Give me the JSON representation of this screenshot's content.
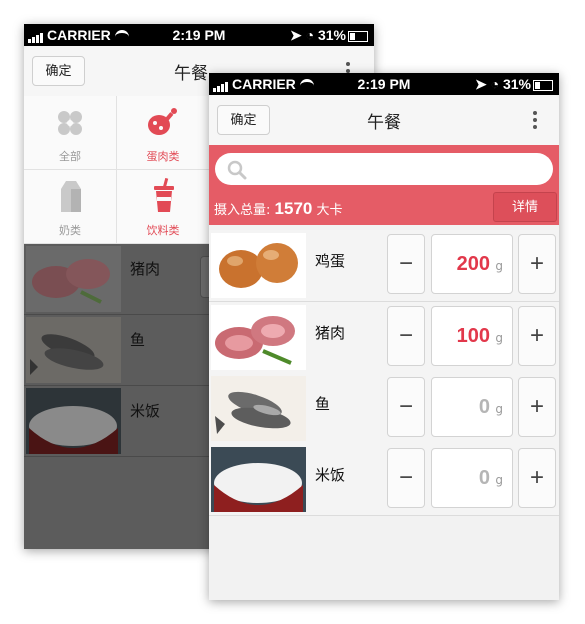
{
  "status_bar": {
    "carrier": "CARRIER",
    "time": "2:19 PM",
    "battery": "31%"
  },
  "back_screen": {
    "confirm_label": "确定",
    "title": "午餐",
    "categories": [
      {
        "label": "全部",
        "icon": "clover-icon",
        "active": false
      },
      {
        "label": "蛋肉类",
        "icon": "meat-icon",
        "active": true
      },
      {
        "label": "奶类",
        "icon": "milk-carton-icon",
        "active": false
      },
      {
        "label": "饮料类",
        "icon": "drink-cup-icon",
        "active": true
      }
    ],
    "foods": [
      {
        "name": "猪肉",
        "image": "pork"
      },
      {
        "name": "鱼",
        "image": "fish"
      },
      {
        "name": "米饭",
        "image": "rice"
      }
    ]
  },
  "front_screen": {
    "confirm_label": "确定",
    "title": "午餐",
    "search": {
      "placeholder": "",
      "icon": "search-icon"
    },
    "summary": {
      "label": "摄入总量:",
      "value": "1570",
      "unit": "大卡"
    },
    "detail_label": "详情",
    "foods": [
      {
        "name": "鸡蛋",
        "image": "eggs",
        "quantity": "200",
        "unit": "g",
        "minus": "−",
        "plus": "+",
        "nonzero": true
      },
      {
        "name": "猪肉",
        "image": "pork",
        "quantity": "100",
        "unit": "g",
        "minus": "−",
        "plus": "+",
        "nonzero": true
      },
      {
        "name": "鱼",
        "image": "fish",
        "quantity": "0",
        "unit": "g",
        "minus": "−",
        "plus": "+",
        "nonzero": false
      },
      {
        "name": "米饭",
        "image": "rice",
        "quantity": "0",
        "unit": "g",
        "minus": "−",
        "plus": "+",
        "nonzero": false
      }
    ]
  },
  "colors": {
    "accent": "#e55c66",
    "active_category": "#e24a55",
    "quantity_active": "#e2384b",
    "quantity_zero": "#b5b5b5"
  }
}
